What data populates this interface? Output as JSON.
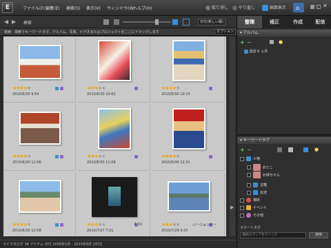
{
  "menubar": {
    "logo": "E",
    "menus": [
      "ファイル(F)",
      "編集(E)",
      "検索(S)",
      "表示(V)",
      "ウィンドウ(W)",
      "ヘルプ(H)"
    ],
    "undo_label": "取り消し",
    "redo_label": "やり直し",
    "display_label": "画面表示"
  },
  "toolbar": {
    "search_label": "検索",
    "sort_value": "日付(新しい順)"
  },
  "searchbar": {
    "text": "検索：検索でキーワードタグ、アルバム、写真、ビデオまたはプロジェクトをここにドラッグします",
    "options_label": "オプション"
  },
  "right_panel": {
    "tabs": [
      "整理",
      "補正",
      "作成",
      "配信"
    ],
    "album_header": "アルバム",
    "album_item": "過去 6 ヵ月",
    "keyword_header": "キーワードタグ",
    "keywords": [
      {
        "label": "人物"
      },
      {
        "label": "おとこ"
      },
      {
        "label": "お姉ちゃん"
      },
      {
        "label": "宝箱"
      },
      {
        "label": "友達"
      },
      {
        "label": "場所"
      },
      {
        "label": "イベント"
      },
      {
        "label": "その他"
      }
    ],
    "smart_tags": "スマートタグ",
    "bottom_input": "選択/メディアをクリック",
    "bottom_button": "適用"
  },
  "grid": {
    "cells": [
      {
        "date": "2010/6/30 9:54",
        "rating": 4,
        "photo": "kids"
      },
      {
        "date": "2010/6/30 10:02",
        "rating": 3,
        "photo": "girl-statue"
      },
      {
        "date": "2010/6/30 10:15",
        "rating": 4,
        "photo": "statue"
      },
      {
        "date": "2010/6/30 11:06",
        "rating": 4,
        "photo": "crab"
      },
      {
        "date": "2010/6/30 11:08",
        "rating": 3,
        "photo": "sign"
      },
      {
        "date": "2010/6/30 12:31",
        "rating": 4,
        "photo": "kid-statue"
      },
      {
        "date": "2010/6/30 12:58",
        "rating": 4,
        "photo": "group"
      },
      {
        "date": "2010/7/27 7:21",
        "rating": 3,
        "photo": "video",
        "duration": "1:32"
      },
      {
        "date": "2010/7/29 9:25",
        "rating": 3,
        "photo": "harbor",
        "version": "バージョンセー"
      }
    ]
  },
  "status": {
    "text": "マイカタログ  38 アイテム  日付 2008年5月 - 2010年8月  [日付]"
  },
  "colors": {
    "star": "#f2a100",
    "accent": "#3b8fd8"
  }
}
